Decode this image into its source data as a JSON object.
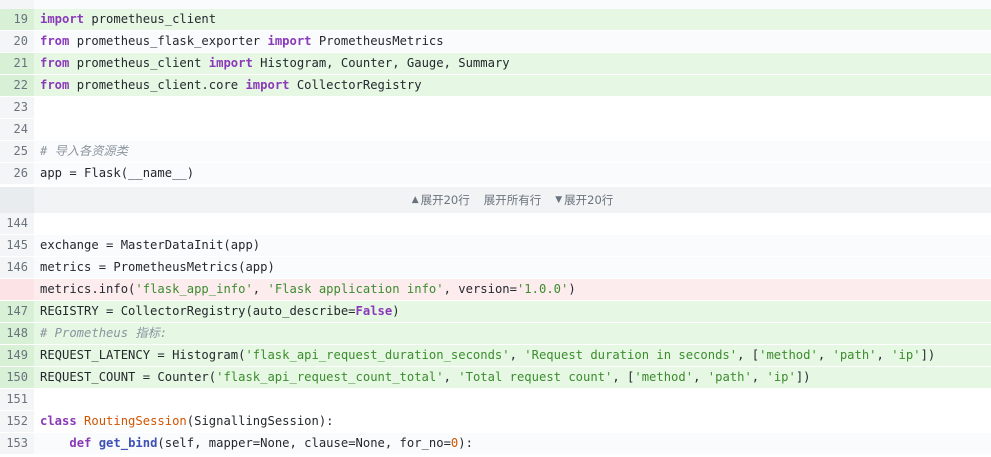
{
  "lines": {
    "l19": {
      "num": "19"
    },
    "l20": {
      "num": "20"
    },
    "l21": {
      "num": "21"
    },
    "l22": {
      "num": "22"
    },
    "l23": {
      "num": "23"
    },
    "l24": {
      "num": "24"
    },
    "l25": {
      "num": "25",
      "comment": "# 导入各资源类"
    },
    "l26": {
      "num": "26"
    },
    "l144": {
      "num": "144"
    },
    "l145": {
      "num": "145"
    },
    "l146": {
      "num": "146"
    },
    "ldel": {
      "num": ""
    },
    "l147": {
      "num": "147"
    },
    "l148": {
      "num": "148",
      "comment": "# Prometheus 指标:"
    },
    "l149": {
      "num": "149"
    },
    "l150": {
      "num": "150"
    },
    "l151": {
      "num": "151"
    },
    "l152": {
      "num": "152"
    },
    "l153": {
      "num": "153"
    }
  },
  "expander": {
    "up_label": "展开20行",
    "all_label": "展开所有行",
    "down_label": "展开20行",
    "up_icon": "triangle-up-icon",
    "down_icon": "triangle-down-icon"
  },
  "tokens": {
    "import": "import",
    "from": "from",
    "class": "class",
    "def": "def",
    "t19": " prometheus_client",
    "t20a": " prometheus_flask_exporter ",
    "t20b": " PrometheusMetrics",
    "t21a": " prometheus_client ",
    "t21b": " Histogram, Counter, Gauge, Summary",
    "t22a": " prometheus_client.core ",
    "t22b": " CollectorRegistry",
    "t26": "app = Flask(__name__)",
    "t145": "exchange = MasterDataInit(app)",
    "t146": "metrics = PrometheusMetrics(app)",
    "tdel1": "metrics.info(",
    "tdel2": "'flask_app_info'",
    "tdel3": ", ",
    "tdel4": "'Flask application info'",
    "tdel5": ", version=",
    "tdel6": "'1.0.0'",
    "tdel7": ")",
    "t147a": "REGISTRY = CollectorRegistry(auto_describe=",
    "t147b": "False",
    "t147c": ")",
    "t149a": "REQUEST_LATENCY = Histogram(",
    "t149b": "'flask_api_request_duration_seconds'",
    "t149c": ", ",
    "t149d": "'Request duration in seconds'",
    "t149e": ", [",
    "t149f": "'method'",
    "t149g": ", ",
    "t149h": "'path'",
    "t149i": ", ",
    "t149j": "'ip'",
    "t149k": "])",
    "t150a": "REQUEST_COUNT = Counter(",
    "t150b": "'flask_api_request_count_total'",
    "t150c": ", ",
    "t150d": "'Total request count'",
    "t150e": ", [",
    "t150f": "'method'",
    "t150g": ", ",
    "t150h": "'path'",
    "t150i": ", ",
    "t150j": "'ip'",
    "t150k": "])",
    "t152a": " ",
    "t152b": "RoutingSession",
    "t152c": "(SignallingSession):",
    "t153a": "    ",
    "t153b": " ",
    "t153c": "get_bind",
    "t153d": "(self, mapper=None, clause=None, for_no=",
    "t153e": "0",
    "t153f": "):"
  },
  "colors": {
    "added_bg": "#e6f7e4",
    "removed_bg": "#fdecee",
    "keyword": "#8a3ab9",
    "string": "#3c8c2e",
    "number": "#d35400"
  }
}
